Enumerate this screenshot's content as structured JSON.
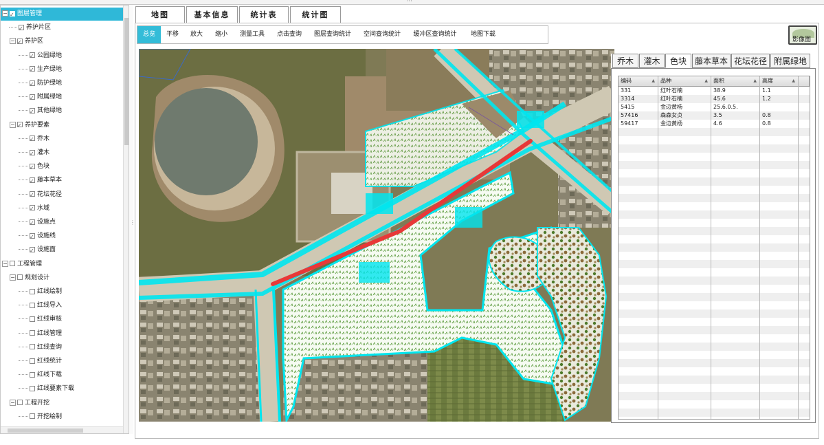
{
  "tree": [
    {
      "label": "图层管理",
      "level": 0,
      "exp": "−",
      "checked": true,
      "selected": true
    },
    {
      "label": "养护片区",
      "level": 1,
      "exp": "",
      "checked": true
    },
    {
      "label": "养护区",
      "level": 1,
      "exp": "−",
      "checked": true
    },
    {
      "label": "公园绿地",
      "level": 2,
      "exp": "",
      "checked": true
    },
    {
      "label": "生产绿地",
      "level": 2,
      "exp": "",
      "checked": true
    },
    {
      "label": "防护绿地",
      "level": 2,
      "exp": "",
      "checked": true
    },
    {
      "label": "附属绿地",
      "level": 2,
      "exp": "",
      "checked": true
    },
    {
      "label": "其他绿地",
      "level": 2,
      "exp": "",
      "checked": true
    },
    {
      "label": "养护要素",
      "level": 1,
      "exp": "−",
      "checked": true
    },
    {
      "label": "乔木",
      "level": 2,
      "exp": "",
      "checked": true
    },
    {
      "label": "灌木",
      "level": 2,
      "exp": "",
      "checked": true
    },
    {
      "label": "色块",
      "level": 2,
      "exp": "",
      "checked": true
    },
    {
      "label": "藤本草本",
      "level": 2,
      "exp": "",
      "checked": true
    },
    {
      "label": "花坛花径",
      "level": 2,
      "exp": "",
      "checked": true
    },
    {
      "label": "水域",
      "level": 2,
      "exp": "",
      "checked": true
    },
    {
      "label": "设施点",
      "level": 2,
      "exp": "",
      "checked": true
    },
    {
      "label": "设施线",
      "level": 2,
      "exp": "",
      "checked": true
    },
    {
      "label": "设施面",
      "level": 2,
      "exp": "",
      "checked": true
    },
    {
      "label": "工程管理",
      "level": 0,
      "exp": "−",
      "checked": false
    },
    {
      "label": "规划设计",
      "level": 1,
      "exp": "−",
      "checked": false
    },
    {
      "label": "红线绘制",
      "level": 2,
      "exp": "",
      "checked": false
    },
    {
      "label": "红线导入",
      "level": 2,
      "exp": "",
      "checked": false
    },
    {
      "label": "红线审核",
      "level": 2,
      "exp": "",
      "checked": false
    },
    {
      "label": "红线管理",
      "level": 2,
      "exp": "",
      "checked": false
    },
    {
      "label": "红线查询",
      "level": 2,
      "exp": "",
      "checked": false
    },
    {
      "label": "红线统计",
      "level": 2,
      "exp": "",
      "checked": false
    },
    {
      "label": "红线下载",
      "level": 2,
      "exp": "",
      "checked": false
    },
    {
      "label": "红线要素下载",
      "level": 2,
      "exp": "",
      "checked": false
    },
    {
      "label": "工程开挖",
      "level": 1,
      "exp": "−",
      "checked": false
    },
    {
      "label": "开挖绘制",
      "level": 2,
      "exp": "",
      "checked": false
    }
  ],
  "main_tabs": [
    "地图",
    "基本信息",
    "统计表",
    "统计图"
  ],
  "toolbar": [
    "总览",
    "平移",
    "放大",
    "缩小",
    "测量工具",
    "点击查询",
    "图层查询统计",
    "空间查询统计",
    "缓冲区查询统计",
    "地图下载"
  ],
  "toolbar_active": 0,
  "image_button": "影像图",
  "right_tabs": [
    "乔木",
    "灌木",
    "色块",
    "藤本草本",
    "花坛花径",
    "附属绿地"
  ],
  "right_tab_active": 2,
  "grid": {
    "columns": [
      "编码",
      "品种",
      "面积",
      "高度"
    ],
    "rows": [
      [
        "331",
        "红叶石楠",
        "38.9",
        "1.1"
      ],
      [
        "3314",
        "红叶石楠",
        "45.6",
        "1.2"
      ],
      [
        "5415",
        "金边黄杨",
        "25.6.0.5.",
        ""
      ],
      [
        "57416",
        "森森女贞",
        "3.5",
        "0.8"
      ],
      [
        "59417",
        "金边黄杨",
        "4.6",
        "0.8"
      ]
    ]
  },
  "colors": {
    "accent": "#33bcd8",
    "highlight_road": "#e83838",
    "greenspace_outline": "#00e5ee"
  }
}
